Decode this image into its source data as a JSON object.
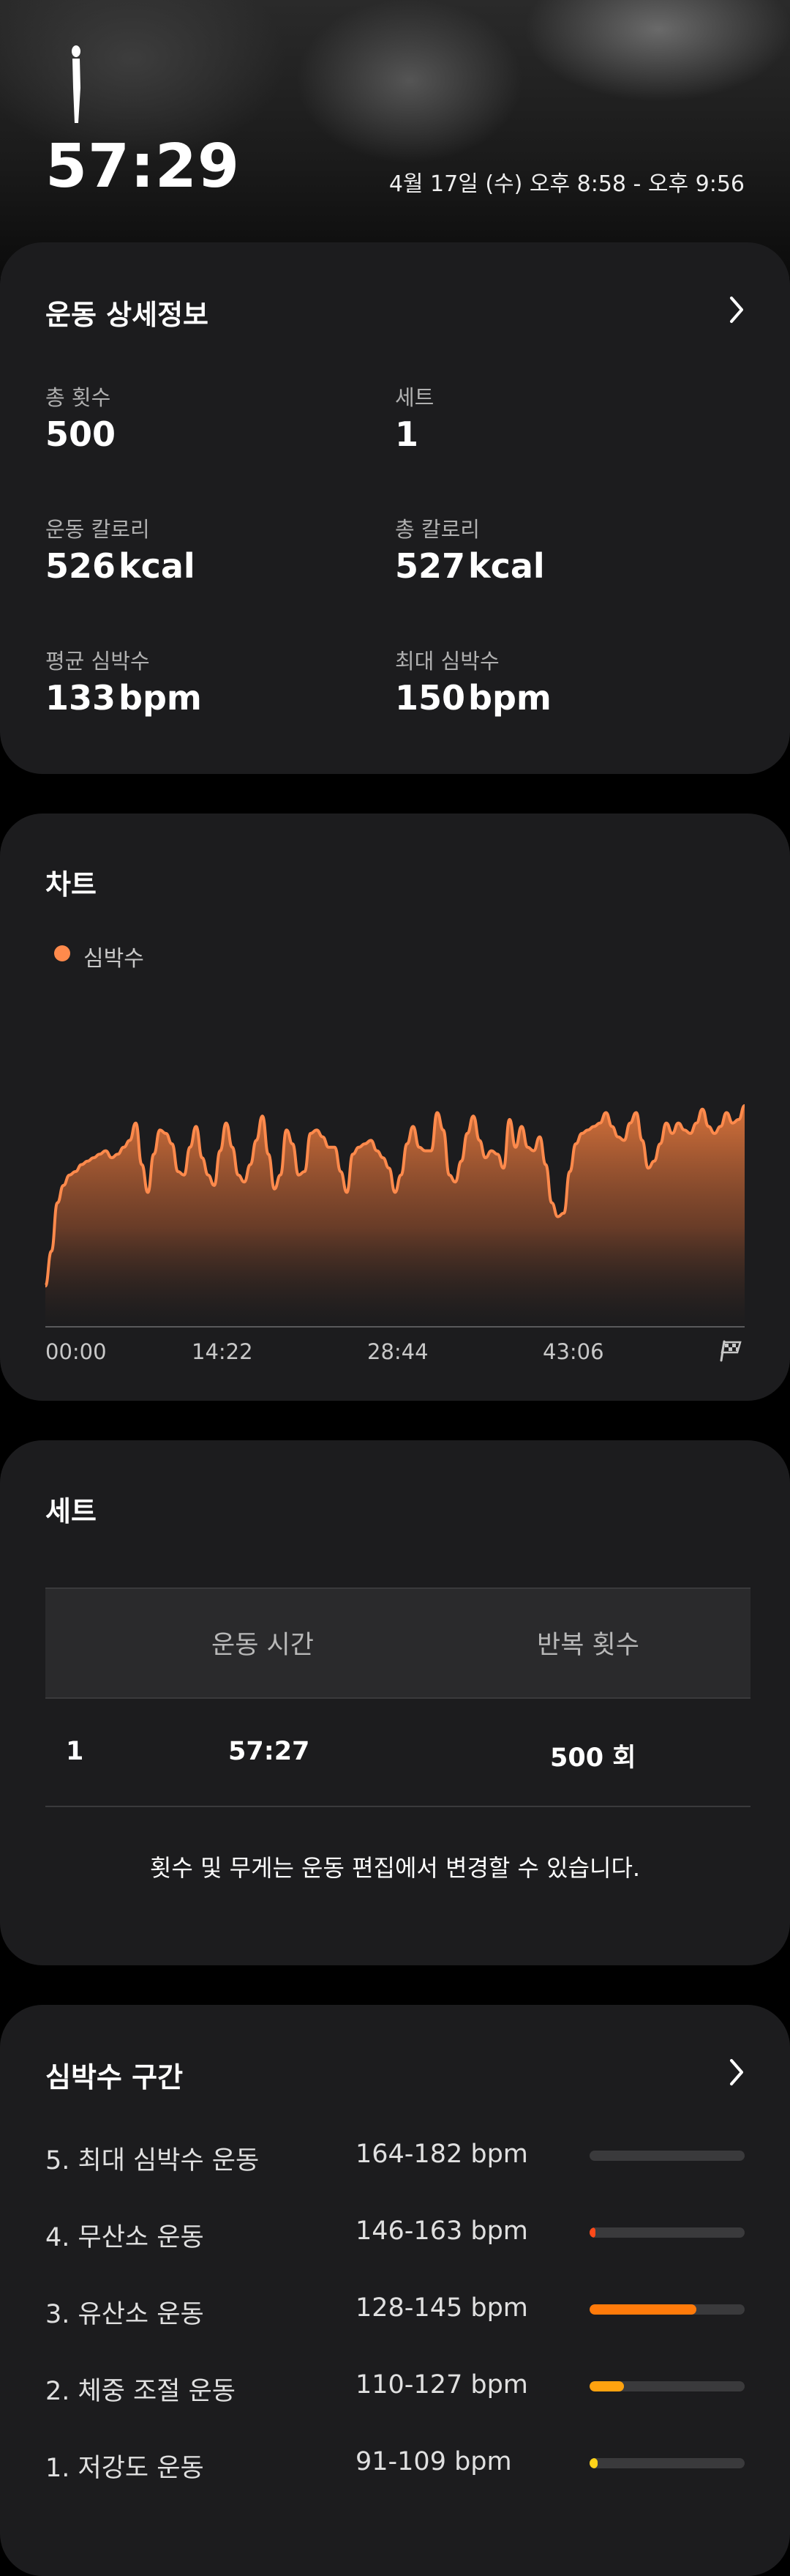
{
  "header": {
    "duration": "57:29",
    "date_range": "4월 17일 (수) 오후 8:58 - 오후 9:56"
  },
  "details": {
    "title": "운동 상세정보",
    "stats": [
      {
        "label": "총 횟수",
        "value": "500",
        "unit": ""
      },
      {
        "label": "세트",
        "value": "1",
        "unit": ""
      },
      {
        "label": "운동 칼로리",
        "value": "526",
        "unit": "kcal"
      },
      {
        "label": "총 칼로리",
        "value": "527",
        "unit": "kcal"
      },
      {
        "label": "평균 심박수",
        "value": "133",
        "unit": "bpm"
      },
      {
        "label": "최대 심박수",
        "value": "150",
        "unit": "bpm"
      }
    ]
  },
  "chart": {
    "title": "차트",
    "legend": "심박수",
    "color": "#ff8a4c"
  },
  "chart_data": {
    "type": "area",
    "title": "",
    "xlabel": "",
    "ylabel": "",
    "x_ticks": [
      "00:00",
      "14:22",
      "28:44",
      "43:06"
    ],
    "series": [
      {
        "name": "심박수",
        "values": [
          100,
          110,
          124,
          129,
          132,
          133,
          135,
          136,
          137,
          138,
          139,
          137,
          138,
          140,
          142,
          147,
          135,
          127,
          138,
          145,
          144,
          141,
          133,
          132,
          140,
          146,
          137,
          132,
          129,
          139,
          147,
          140,
          132,
          130,
          135,
          142,
          149,
          138,
          128,
          132,
          145,
          141,
          132,
          133,
          144,
          145,
          143,
          140,
          140,
          133,
          127,
          138,
          140,
          141,
          142,
          139,
          137,
          134,
          127,
          132,
          141,
          146,
          140,
          139,
          139,
          150,
          145,
          132,
          130,
          136,
          144,
          149,
          142,
          137,
          139,
          138,
          134,
          148,
          140,
          146,
          140,
          139,
          143,
          135,
          124,
          120,
          121,
          133,
          141,
          144,
          145,
          146,
          147,
          150,
          146,
          143,
          142,
          147,
          150,
          142,
          134,
          136,
          141,
          147,
          144,
          147,
          145,
          144,
          147,
          151,
          146,
          144,
          146,
          150,
          147,
          148,
          152
        ]
      }
    ],
    "ylim": [
      95,
      152
    ],
    "grid": false
  },
  "sets": {
    "title": "세트",
    "headers": [
      "운동 시간",
      "반복 횟수"
    ],
    "rows": [
      {
        "set": "1",
        "time": "57:27",
        "reps": "500 회"
      }
    ],
    "note": "횟수 및 무게는 운동 편집에서 변경할 수 있습니다."
  },
  "zones": {
    "title": "심박수 구간",
    "items": [
      {
        "name": "5. 최대 심박수 운동",
        "range": "164-182 bpm",
        "fraction": 0.0,
        "color": "#ff3b1f"
      },
      {
        "name": "4. 무산소 운동",
        "range": "146-163 bpm",
        "fraction": 0.04,
        "color": "#ff4a1a"
      },
      {
        "name": "3. 유산소 운동",
        "range": "128-145 bpm",
        "fraction": 0.69,
        "color": "#ff7a0a"
      },
      {
        "name": "2. 체중 조절 운동",
        "range": "110-127 bpm",
        "fraction": 0.22,
        "color": "#ffa20f"
      },
      {
        "name": "1. 저강도 운동",
        "range": "91-109 bpm",
        "fraction": 0.05,
        "color": "#ffd31a"
      }
    ]
  }
}
